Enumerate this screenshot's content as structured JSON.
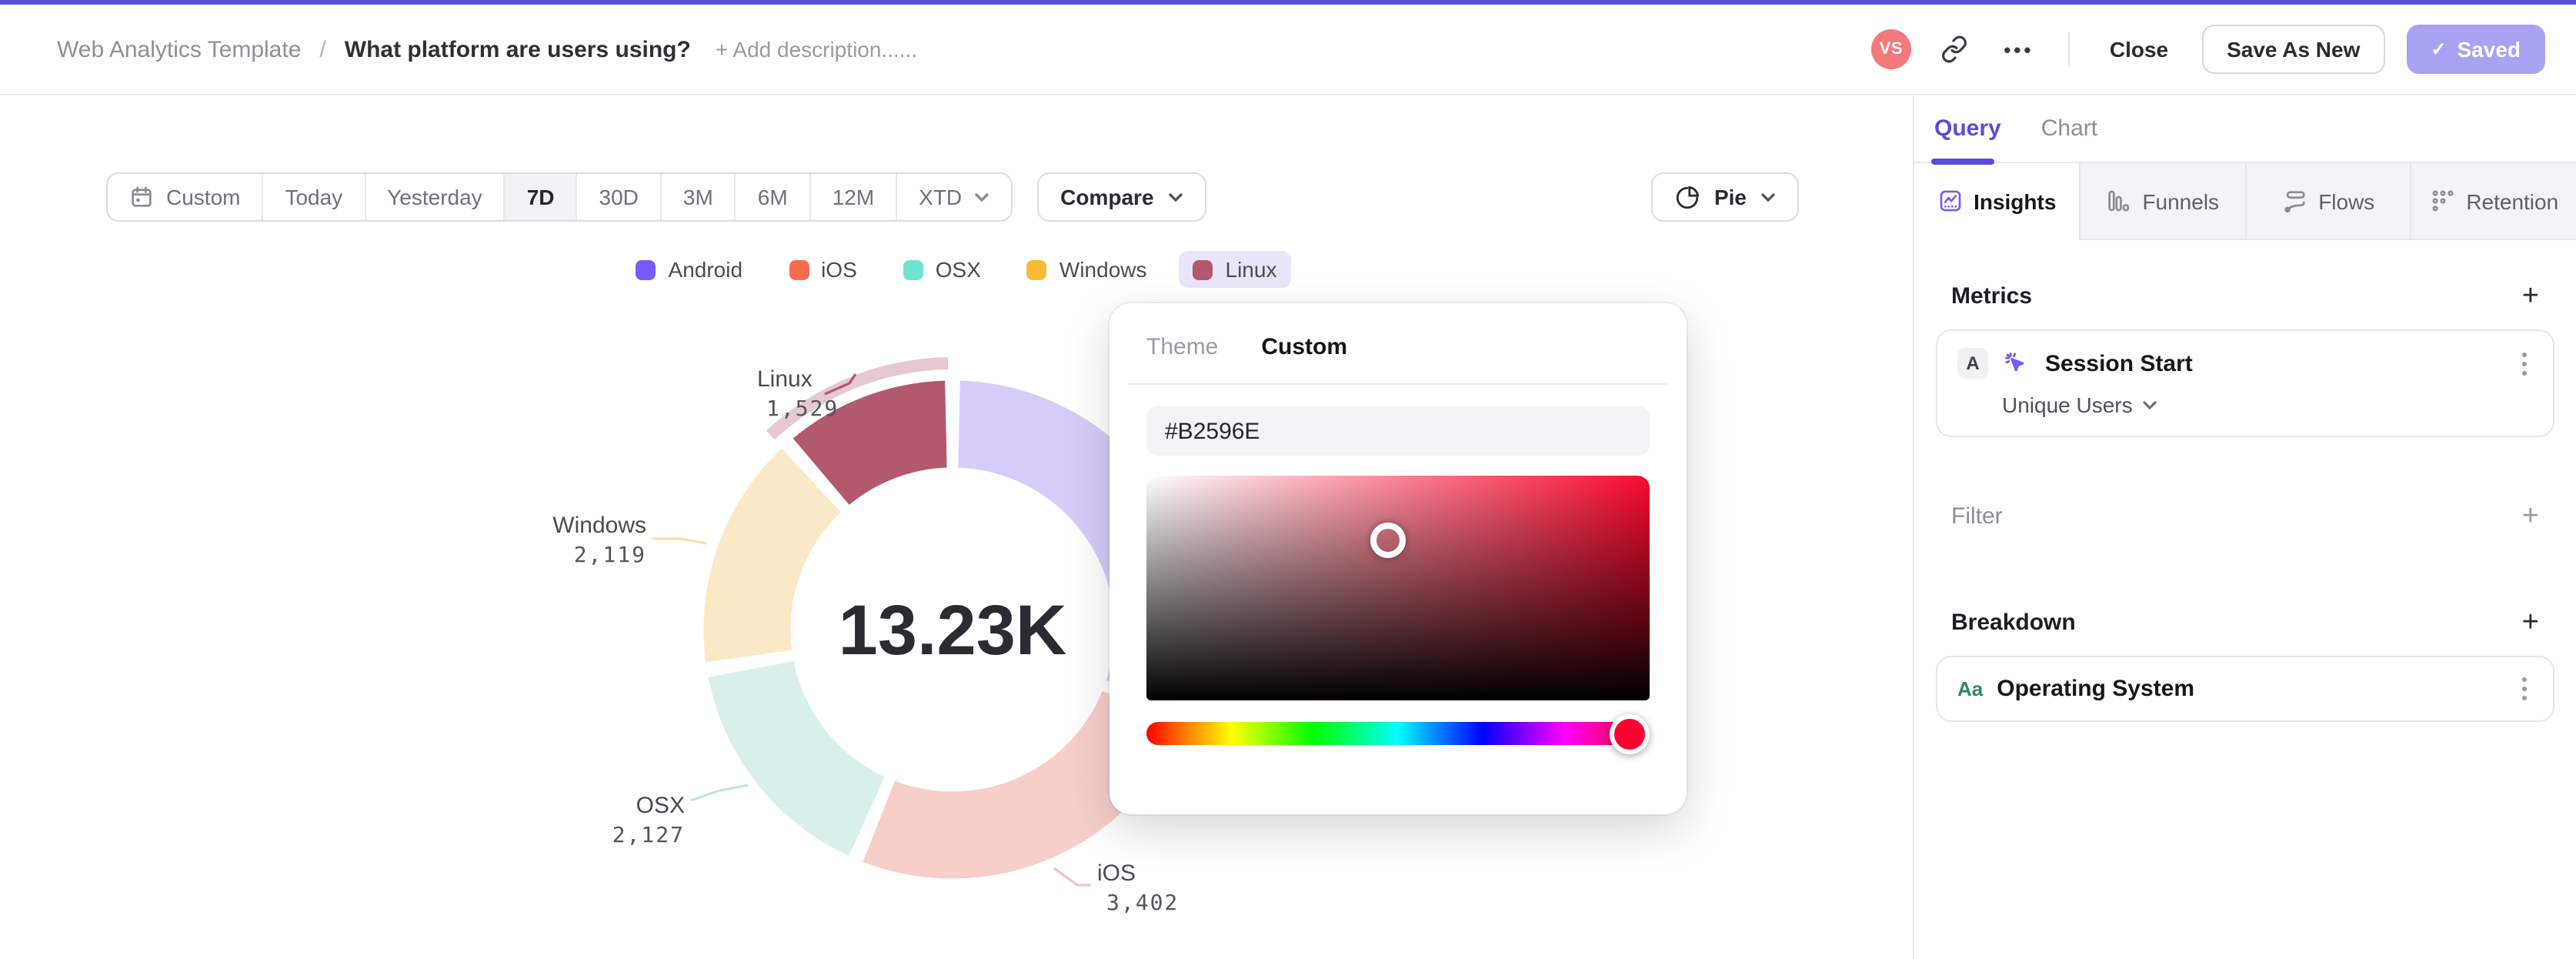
{
  "header": {
    "breadcrumb_root": "Web Analytics Template",
    "breadcrumb_separator": "/",
    "title": "What platform are users using?",
    "add_description": "+ Add description......",
    "avatar_initials": "VS",
    "more_label": "•••",
    "close_label": "Close",
    "save_as_new_label": "Save As New",
    "saved_check": "✓",
    "saved_label": "Saved"
  },
  "toolbar": {
    "date_ranges": [
      {
        "label": "Custom",
        "icon": "calendar",
        "selected": false
      },
      {
        "label": "Today",
        "selected": false
      },
      {
        "label": "Yesterday",
        "selected": false
      },
      {
        "label": "7D",
        "selected": true
      },
      {
        "label": "30D",
        "selected": false
      },
      {
        "label": "3M",
        "selected": false
      },
      {
        "label": "6M",
        "selected": false
      },
      {
        "label": "12M",
        "selected": false
      },
      {
        "label": "XTD",
        "caret": true,
        "selected": false
      }
    ],
    "compare_label": "Compare",
    "chart_type_label": "Pie"
  },
  "legend": {
    "items": [
      {
        "label": "Android",
        "color": "#7A5AF8",
        "highlighted": false
      },
      {
        "label": "iOS",
        "color": "#FA6A4D",
        "highlighted": false
      },
      {
        "label": "OSX",
        "color": "#6FE3CD",
        "highlighted": false
      },
      {
        "label": "Windows",
        "color": "#F7BB36",
        "highlighted": false
      },
      {
        "label": "Linux",
        "color": "#B2596E",
        "highlighted": true
      }
    ]
  },
  "chart_data": {
    "type": "pie",
    "center_label": "13.23K",
    "start_angle": "top",
    "direction": "clockwise",
    "categories": [
      "Android",
      "iOS",
      "OSX",
      "Windows",
      "Linux"
    ],
    "values": [
      4053,
      3402,
      2127,
      2119,
      1529
    ],
    "slices": [
      {
        "name": "Android",
        "value": 4053,
        "label": null,
        "color": "#7A5AF8",
        "fill": "#D6CCF9",
        "highlighted": false
      },
      {
        "name": "iOS",
        "value": 3402,
        "label": "3,402",
        "color": "#FA6A4D",
        "fill": "#F8CEC9",
        "highlighted": false
      },
      {
        "name": "OSX",
        "value": 2127,
        "label": "2,127",
        "color": "#6FE3CD",
        "fill": "#D7F1EA",
        "highlighted": false
      },
      {
        "name": "Windows",
        "value": 2119,
        "label": "2,119",
        "color": "#F7BB36",
        "fill": "#FBE8C6",
        "highlighted": false
      },
      {
        "name": "Linux",
        "value": 1529,
        "label": "1,529",
        "color": "#B2596E",
        "fill": "#B2596E",
        "highlighted": true
      }
    ],
    "highlight_band_color": "rgba(178,89,110,0.33)",
    "connector_colors": {
      "iOS": "#F5C2BC",
      "OSX": "#BCE7DA",
      "Windows": "#F4DFAE",
      "Linux": "#B2596E"
    }
  },
  "color_picker": {
    "tabs": [
      "Theme",
      "Custom"
    ],
    "active_tab": "Custom",
    "hex_value": "#B2596E",
    "gradient_hue_color": "#FA0A2E",
    "cursor_x_percent": 48,
    "cursor_y_percent": 29,
    "hue_percent": 96,
    "hue_handle_color": "#FF0030"
  },
  "sidebar": {
    "query_tab": "Query",
    "chart_tab": "Chart",
    "modes": [
      {
        "label": "Insights",
        "icon": "insights",
        "active": true
      },
      {
        "label": "Funnels",
        "icon": "funnels",
        "active": false
      },
      {
        "label": "Flows",
        "icon": "flows",
        "active": false
      },
      {
        "label": "Retention",
        "icon": "retention",
        "active": false
      }
    ],
    "metrics": {
      "heading": "Metrics",
      "add_label": "+",
      "card": {
        "badge": "A",
        "title": "Session Start",
        "subtitle": "Unique Users"
      }
    },
    "filter": {
      "heading": "Filter",
      "add_label": "+"
    },
    "breakdown": {
      "heading": "Breakdown",
      "add_label": "+",
      "card": {
        "icon_label": "Aa",
        "title": "Operating System"
      }
    }
  },
  "colors": {
    "accent": "#5B4BDB",
    "icon_purple": "#7A5AF8",
    "avatar_bg": "#F4797B",
    "saved_button_bg": "#A8A2F2",
    "legend_highlight_bg": "#E9E6FB"
  }
}
